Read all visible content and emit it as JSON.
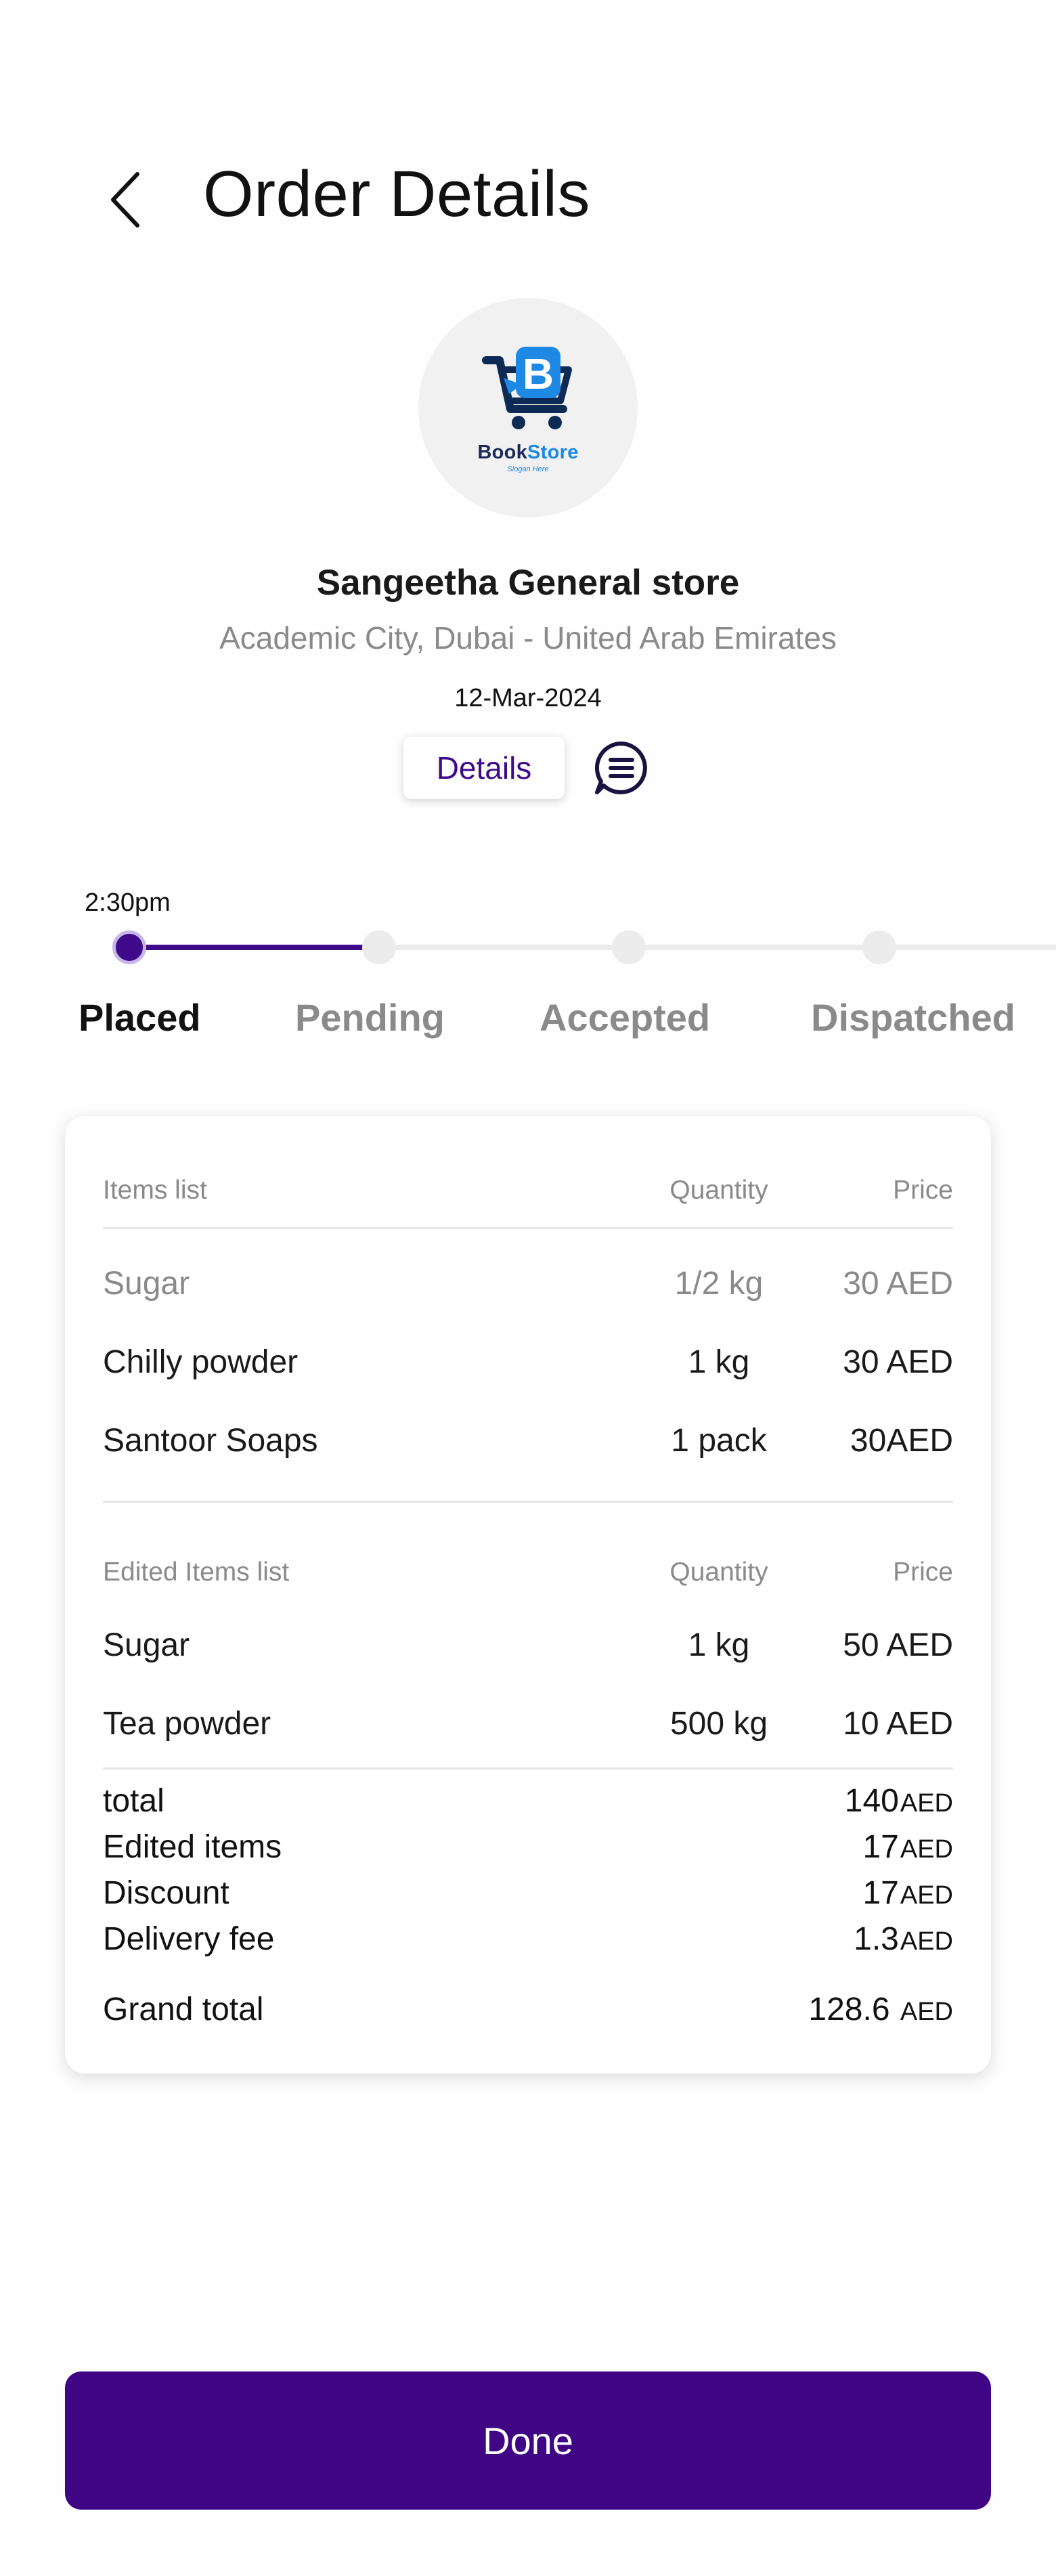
{
  "header": {
    "title": "Order Details"
  },
  "logo": {
    "brand_part1": "Book",
    "brand_part2": "Store",
    "slogan": "Slogan Here",
    "letter": "B"
  },
  "store": {
    "name": "Sangeetha General store",
    "address": "Academic City, Dubai - United Arab Emirates",
    "date": "12-Mar-2024",
    "details_label": "Details"
  },
  "tracking": {
    "time": "2:30pm",
    "steps": [
      {
        "label": "Placed",
        "active": true
      },
      {
        "label": "Pending",
        "active": false
      },
      {
        "label": "Accepted",
        "active": false
      },
      {
        "label": "Dispatched",
        "active": false
      }
    ]
  },
  "items": {
    "header": {
      "name": "Items list",
      "quantity": "Quantity",
      "price": "Price"
    },
    "rows": [
      {
        "name": "Sugar",
        "quantity": "1/2 kg",
        "price": "30 AED",
        "muted": true
      },
      {
        "name": "Chilly powder",
        "quantity": "1 kg",
        "price": "30 AED",
        "muted": false
      },
      {
        "name": "Santoor Soaps",
        "quantity": "1 pack",
        "price": "30AED",
        "muted": false
      }
    ]
  },
  "edited_items": {
    "header": {
      "name": "Edited Items list",
      "quantity": "Quantity",
      "price": "Price"
    },
    "rows": [
      {
        "name": "Sugar",
        "quantity": "1 kg",
        "price": "50 AED"
      },
      {
        "name": "Tea powder",
        "quantity": "500 kg",
        "price": "10 AED"
      }
    ]
  },
  "summary": {
    "total": {
      "label": "total",
      "value": "140",
      "unit": "AED"
    },
    "edited": {
      "label": "Edited items",
      "value": "17",
      "unit": "AED"
    },
    "discount": {
      "label": "Discount",
      "value": "17",
      "unit": "AED"
    },
    "delivery": {
      "label": "Delivery fee",
      "value": "1.3",
      "unit": "AED"
    },
    "grand": {
      "label": "Grand total",
      "value": "128.6 ",
      "unit": "AED"
    }
  },
  "footer": {
    "done_label": "Done"
  },
  "colors": {
    "primary": "#3f0584",
    "muted": "#8a8a8a",
    "track": "#ececec"
  }
}
